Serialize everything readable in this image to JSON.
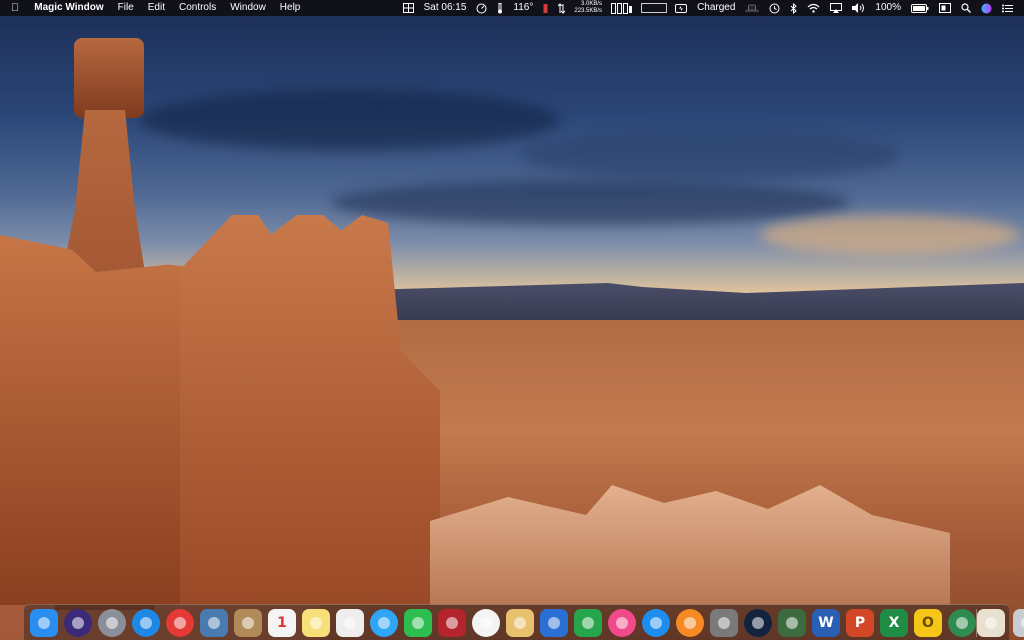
{
  "menubar": {
    "apple_icon": "apple-logo-icon",
    "app_name": "Magic Window",
    "menus": [
      "File",
      "Edit",
      "Controls",
      "Window",
      "Help"
    ],
    "status": {
      "clock": "Sat 06:15",
      "temperature": "116°",
      "net_up": "3.0KB/s",
      "net_down": "223.5KB/s",
      "battery_status_label": "Charged",
      "battery_percent": "100%"
    }
  },
  "dock": {
    "apps": [
      {
        "name": "Finder",
        "icon": "finder-icon",
        "color": "#2a8df0"
      },
      {
        "name": "Siri",
        "icon": "siri-icon",
        "color": "#3b2a7a"
      },
      {
        "name": "Launchpad",
        "icon": "rocket-icon",
        "color": "#8a8f99"
      },
      {
        "name": "Safari",
        "icon": "compass-icon",
        "color": "#1e88e5"
      },
      {
        "name": "Chrome",
        "icon": "chrome-icon",
        "color": "#e53935"
      },
      {
        "name": "Preview",
        "icon": "photo-icon",
        "color": "#4a7bb0"
      },
      {
        "name": "Contacts",
        "icon": "contacts-book-icon",
        "color": "#b08a58"
      },
      {
        "name": "Calendar",
        "icon": "calendar-icon",
        "color": "#f4f4f4",
        "text": "1"
      },
      {
        "name": "Notes",
        "icon": "notes-icon",
        "color": "#f7e07a"
      },
      {
        "name": "Reminders",
        "icon": "reminders-icon",
        "color": "#eeeeee"
      },
      {
        "name": "Messages",
        "icon": "speech-bubble-icon",
        "color": "#2fa5f5"
      },
      {
        "name": "FaceTime",
        "icon": "video-camera-icon",
        "color": "#2ebd4f"
      },
      {
        "name": "Photo Booth",
        "icon": "photo-booth-icon",
        "color": "#b3242c"
      },
      {
        "name": "Photos",
        "icon": "flower-icon",
        "color": "#f4f4f4"
      },
      {
        "name": "TextEdit",
        "icon": "pen-paper-icon",
        "color": "#e7c16e"
      },
      {
        "name": "Keynote",
        "icon": "presentation-icon",
        "color": "#2a6fd6"
      },
      {
        "name": "Numbers",
        "icon": "bar-chart-icon",
        "color": "#27a54b"
      },
      {
        "name": "iTunes",
        "icon": "music-note-icon",
        "color": "#f04a8a"
      },
      {
        "name": "App Store",
        "icon": "app-store-icon",
        "color": "#1d8ef0"
      },
      {
        "name": "iBooks",
        "icon": "book-icon",
        "color": "#f58a24"
      },
      {
        "name": "System Preferences",
        "icon": "gear-icon",
        "color": "#7a7a7a"
      },
      {
        "name": "Speedometer",
        "icon": "speedometer-icon",
        "color": "#12233f"
      },
      {
        "name": "Magic Window",
        "icon": "landscape-window-icon",
        "color": "#3b6b3f"
      },
      {
        "name": "Word",
        "icon": "word-icon",
        "color": "#2b5fb5",
        "text": "W"
      },
      {
        "name": "PowerPoint",
        "icon": "powerpoint-icon",
        "color": "#d24726",
        "text": "P"
      },
      {
        "name": "Excel",
        "icon": "excel-icon",
        "color": "#1f8d45",
        "text": "X"
      },
      {
        "name": "Outlook",
        "icon": "outlook-icon",
        "color": "#f5c518",
        "text": "O"
      },
      {
        "name": "Network Radar",
        "icon": "globe-download-icon",
        "color": "#2f8b4f"
      }
    ],
    "stack_items": [
      {
        "name": "Documents stack",
        "icon": "document-stack-icon",
        "color": "#e9e1cf"
      },
      {
        "name": "Trash",
        "icon": "trash-icon",
        "color": "#c9ccd1"
      }
    ]
  }
}
